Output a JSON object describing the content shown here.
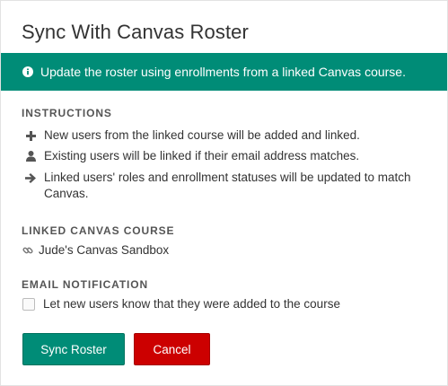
{
  "dialog": {
    "title": "Sync With Canvas Roster"
  },
  "banner": {
    "icon": "info-circle-icon",
    "text": "Update the roster using enrollments from a linked Canvas course.",
    "background": "#008c77"
  },
  "instructions": {
    "heading": "INSTRUCTIONS",
    "items": [
      {
        "icon": "plus-icon",
        "text": "New users from the linked course will be added and linked."
      },
      {
        "icon": "user-icon",
        "text": "Existing users will be linked if their email address matches."
      },
      {
        "icon": "arrow-right-icon",
        "text": "Linked users' roles and enrollment statuses will be updated to match Canvas."
      }
    ]
  },
  "linked_course": {
    "heading": "LINKED CANVAS COURSE",
    "icon": "link-icon",
    "name": "Jude's Canvas Sandbox"
  },
  "email_notification": {
    "heading": "EMAIL NOTIFICATION",
    "checkbox_label": "Let new users know that they were added to the course",
    "checked": false
  },
  "actions": {
    "sync_label": "Sync Roster",
    "cancel_label": "Cancel",
    "sync_color": "#008c77",
    "cancel_color": "#cc0000"
  }
}
